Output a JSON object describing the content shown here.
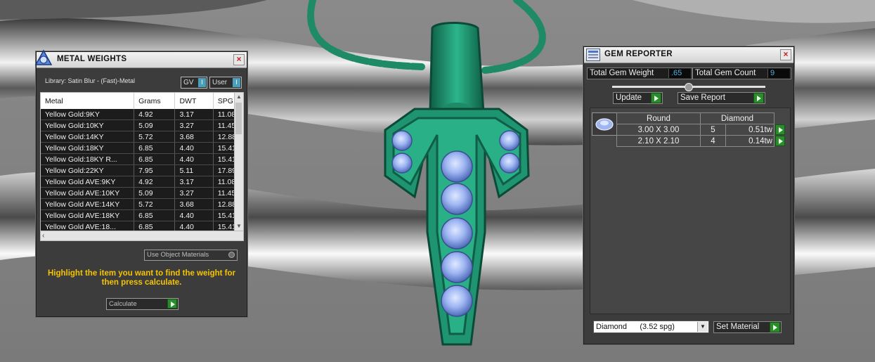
{
  "colors": {
    "jewelry": "#1e8a6a",
    "gem": "#8aa8f0",
    "accent_yellow": "#f5c400",
    "value_blue": "#4fb0e0",
    "button_green": "#2a8c2a"
  },
  "metal_weights": {
    "title": "METAL WEIGHTS",
    "icon": "metal-weights-app-icon",
    "close": "×",
    "library": "Library: Satin Blur - (Fast)-Metal",
    "gv_toggle": "GV",
    "user_toggle": "User",
    "toggle_badge": "I",
    "columns": [
      "Metal",
      "Grams",
      "DWT",
      "SPG"
    ],
    "rows": [
      [
        "Yellow Gold:9KY",
        "4.92",
        "3.17",
        "11.08"
      ],
      [
        "Yellow Gold:10KY",
        "5.09",
        "3.27",
        "11.45"
      ],
      [
        "Yellow Gold:14KY",
        "5.72",
        "3.68",
        "12.88"
      ],
      [
        "Yellow Gold:18KY",
        "6.85",
        "4.40",
        "15.41"
      ],
      [
        "Yellow Gold:18KY R...",
        "6.85",
        "4.40",
        "15.41"
      ],
      [
        "Yellow Gold:22KY",
        "7.95",
        "5.11",
        "17.89"
      ],
      [
        "Yellow Gold AVE:9KY",
        "4.92",
        "3.17",
        "11.08"
      ],
      [
        "Yellow Gold AVE:10KY",
        "5.09",
        "3.27",
        "11.45"
      ],
      [
        "Yellow Gold AVE:14KY",
        "5.72",
        "3.68",
        "12.88"
      ],
      [
        "Yellow Gold AVE:18KY",
        "6.85",
        "4.40",
        "15.41"
      ],
      [
        "Yellow Gold AVE:18...",
        "6.85",
        "4.40",
        "15.41"
      ]
    ],
    "use_object_materials": "Use Object Materials",
    "instructions": "Highlight the item you want to find the weight for then press calculate.",
    "calculate": "Calculate"
  },
  "gem_reporter": {
    "title": "GEM REPORTER",
    "icon": "gem-reporter-app-icon",
    "close": "×",
    "total_weight_label": "Total Gem Weight",
    "total_weight_value": ".65",
    "total_count_label": "Total Gem Count",
    "total_count_value": "9",
    "update": "Update",
    "save_report": "Save Report",
    "header": [
      "Round",
      "Diamond"
    ],
    "gems": [
      {
        "size": "3.00 X 3.00",
        "count": "5",
        "weight": "0.51tw"
      },
      {
        "size": "2.10 X 2.10",
        "count": "4",
        "weight": "0.14tw"
      }
    ],
    "material_select": "Diamond      (3.52 spg)",
    "set_material": "Set Material"
  }
}
